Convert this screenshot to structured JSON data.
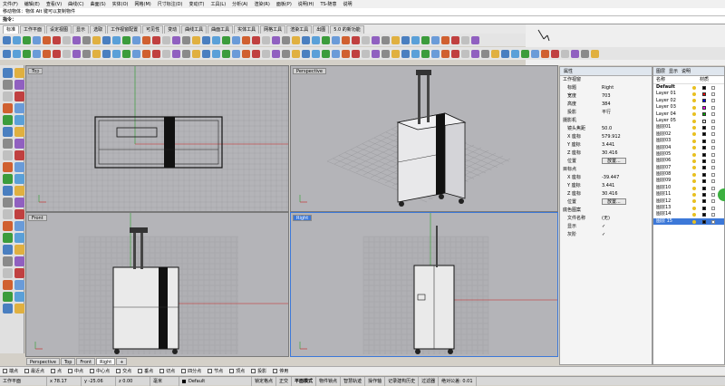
{
  "menu": [
    "文件(F)",
    "编辑(E)",
    "查看(V)",
    "曲线(C)",
    "曲面(S)",
    "实体(O)",
    "网格(M)",
    "尺寸标注(D)",
    "变动(T)",
    "工具(L)",
    "分析(A)",
    "渲染(R)",
    "面板(P)",
    "说明(H)",
    "TS-随意",
    "说明"
  ],
  "command_history": "移动物体：物体 AIt 键可以复制物件",
  "command_prompt": "指令：",
  "toolbar_tabs": [
    "标准",
    "工作平面",
    "设定视图",
    "显示",
    "选取",
    "工作视窗配置",
    "可见性",
    "变动",
    "曲线工具",
    "曲面工具",
    "实体工具",
    "网格工具",
    "渲染工具",
    "出图",
    "5.0 的新功能"
  ],
  "viewports": {
    "top": {
      "label": "Top"
    },
    "perspective": {
      "label": "Perspective"
    },
    "front": {
      "label": "Front"
    },
    "right": {
      "label": "Right"
    }
  },
  "viewport_tabs": [
    "Perspective",
    "Top",
    "Front",
    "Right"
  ],
  "properties": {
    "title": "属性",
    "section_viewport": "工作视窗",
    "rows_viewport": [
      {
        "k": "标题",
        "v": "Right"
      },
      {
        "k": "宽度",
        "v": "703"
      },
      {
        "k": "高度",
        "v": "384"
      },
      {
        "k": "投影",
        "v": "平行"
      }
    ],
    "section_camera": "摄影机",
    "rows_camera": [
      {
        "k": "镜头焦距",
        "v": "50.0"
      },
      {
        "k": "X 座标",
        "v": "579.912"
      },
      {
        "k": "Y 座标",
        "v": "3.441"
      },
      {
        "k": "Z 座标",
        "v": "30.416"
      },
      {
        "k": "位置",
        "v": "放置..."
      }
    ],
    "section_target": "目标点",
    "rows_target": [
      {
        "k": "X 座标",
        "v": "-39.447"
      },
      {
        "k": "Y 座标",
        "v": "3.441"
      },
      {
        "k": "Z 座标",
        "v": "30.416"
      },
      {
        "k": "位置",
        "v": "放置..."
      }
    ],
    "section_wallpaper": "底色图案",
    "rows_wallpaper": [
      {
        "k": "文件名称",
        "v": "(无)"
      },
      {
        "k": "显示",
        "v": "✓"
      },
      {
        "k": "灰阶",
        "v": "✓"
      }
    ]
  },
  "layers_panel": {
    "tabs": [
      "图层",
      "显示",
      "说明"
    ],
    "col_name": "名称",
    "col_material": "材质",
    "items": [
      {
        "name": "Default",
        "color": "#000000"
      },
      {
        "name": "Layer 01",
        "color": "#ff0000"
      },
      {
        "name": "Layer 02",
        "color": "#0000ff"
      },
      {
        "name": "Layer 03",
        "color": "#ff00ff"
      },
      {
        "name": "Layer 04",
        "color": "#00aa00"
      },
      {
        "name": "Layer 05",
        "color": "#ffffff"
      },
      {
        "name": "图层01",
        "color": "#000000"
      },
      {
        "name": "图层02",
        "color": "#000000"
      },
      {
        "name": "图层03",
        "color": "#000000"
      },
      {
        "name": "图层04",
        "color": "#000000"
      },
      {
        "name": "图层05",
        "color": "#000000"
      },
      {
        "name": "图层06",
        "color": "#000000"
      },
      {
        "name": "图层07",
        "color": "#000000"
      },
      {
        "name": "图层08",
        "color": "#000000"
      },
      {
        "name": "图层09",
        "color": "#000000"
      },
      {
        "name": "图层10",
        "color": "#000000"
      },
      {
        "name": "图层11",
        "color": "#000000"
      },
      {
        "name": "图层12",
        "color": "#000000"
      },
      {
        "name": "图层13",
        "color": "#000000"
      },
      {
        "name": "图层14",
        "color": "#000000"
      },
      {
        "name": "图层 15",
        "color": "#000000"
      }
    ]
  },
  "osnaps": [
    "端点",
    "最近点",
    "点",
    "中点",
    "中心点",
    "交点",
    "垂点",
    "切点",
    "四分点",
    "节点",
    "顶点",
    "投影",
    "停用"
  ],
  "status": {
    "cplane": "工作平面",
    "x": "x 78.17",
    "y": "y -25.06",
    "z": "z 0.00",
    "unit": "毫米",
    "layer": "Default",
    "grid_snap": "锁定格点",
    "ortho": "正交",
    "planar": "平面模式",
    "osnap": "物件锁点",
    "smarttrack": "智慧轨迹",
    "gumball": "操作轴",
    "history": "记录建构历史",
    "filter": "过滤器",
    "tolerance": "绝对公差: 0.01"
  }
}
